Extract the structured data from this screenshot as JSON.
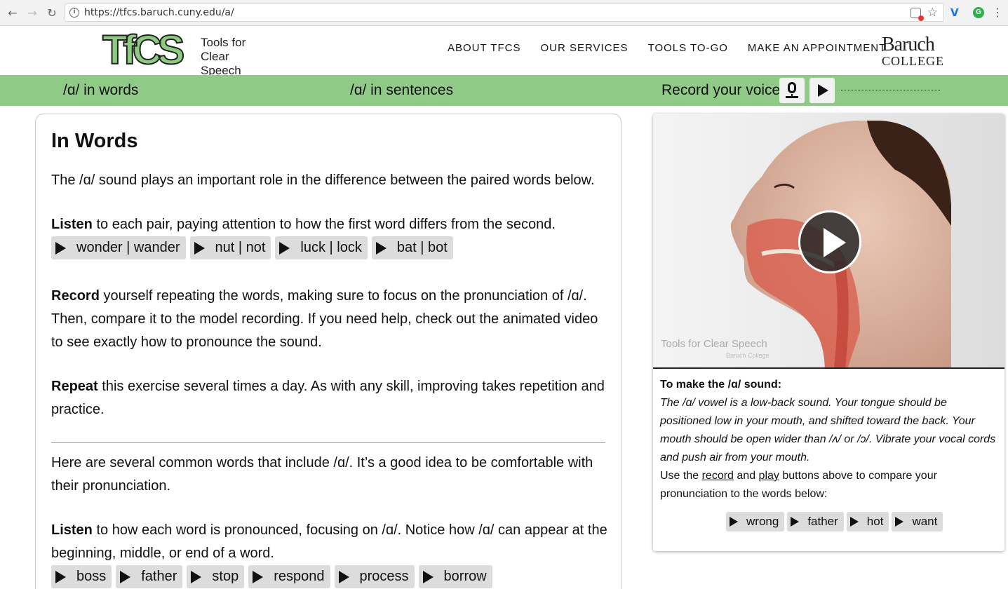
{
  "browser": {
    "url": "https://tfcs.baruch.cuny.edu/a/"
  },
  "header": {
    "logo_mark": "TfCS",
    "logo_line1": "Tools for",
    "logo_line2": "Clear Speech",
    "nav": [
      "ABOUT TFCS",
      "OUR SERVICES",
      "TOOLS TO-GO",
      "MAKE AN APPOINTMENT"
    ],
    "college_line1": "Baruch",
    "college_line2": "COLLEGE"
  },
  "greenbar": {
    "link1": "/ɑ/ in words",
    "link2": "/ɑ/ in sentences",
    "record_label": "Record your voice:"
  },
  "main": {
    "title": "In Words",
    "intro": "The /ɑ/ sound plays an important role in the difference between the paired words below.",
    "listen1_bold": "Listen",
    "listen1_text": " to each pair, paying attention to how the first word differs from the second.",
    "pairs": [
      "wonder | wander",
      "nut | not",
      "luck | lock",
      "bat | bot"
    ],
    "record_bold": "Record",
    "record_text": " yourself repeating the words, making sure to focus on the pronunciation of /ɑ/. Then, compare it to the model recording. If you need help, check out the animated video to see exactly how to pronounce the sound.",
    "repeat_bold": "Repeat",
    "repeat_text": " this exercise several times a day. As with any skill, improving takes repetition and practice.",
    "common_intro": "Here are several common words that include /ɑ/. It’s a good idea to be comfortable with their pronunciation.",
    "listen2_bold": "Listen",
    "listen2_text": " to how each word is pronounced, focusing on /ɑ/. Notice how /ɑ/ can appear at the beginning, middle, or end of a word.",
    "common_words": [
      "boss",
      "father",
      "stop",
      "respond",
      "process",
      "borrow"
    ]
  },
  "card": {
    "watermark": "Tools for Clear Speech",
    "watermark_small": "Baruch College",
    "title": "To make the /ɑ/ sound:",
    "body": "The /ɑ/ vowel is a low-back sound. Your tongue should be positioned low in your mouth, and shifted toward the back. Your mouth should be open wider than /ʌ/ or /ɔ/. Vibrate your vocal cords and push air from your mouth.",
    "use_prefix": "Use the ",
    "use_record": "record",
    "use_and": " and ",
    "use_play": "play",
    "use_suffix": " buttons above to compare your pronunciation to the words below:",
    "words": [
      "wrong",
      "father",
      "hot",
      "want"
    ]
  },
  "colors": {
    "green_bar": "#8fcb87",
    "chip_bg": "#dcdcdc"
  }
}
